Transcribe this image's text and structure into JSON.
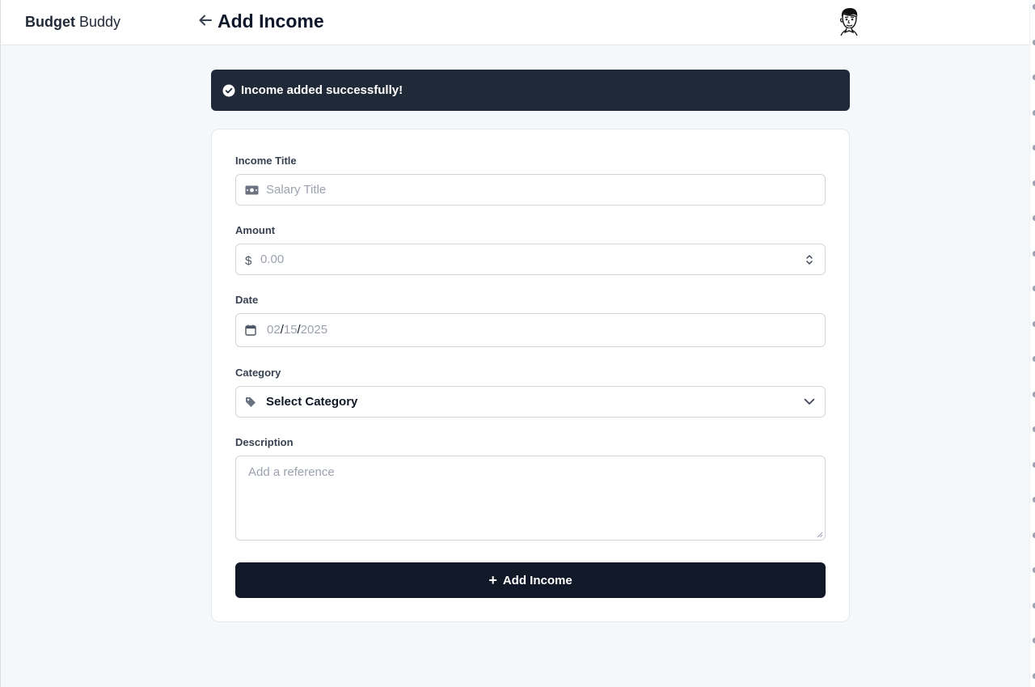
{
  "app": {
    "brand_bold": "Budget",
    "brand_regular": "Buddy"
  },
  "header": {
    "title": "Add Income",
    "back_icon": "arrow-left-icon",
    "avatar_icon": "user-avatar-illustration"
  },
  "toast": {
    "message": "Income added successfully!",
    "icon": "check-circle-icon"
  },
  "form": {
    "income_title": {
      "label": "Income Title",
      "placeholder": "Salary Title",
      "icon": "money-bill-icon"
    },
    "amount": {
      "label": "Amount",
      "prefix": "$",
      "placeholder": "0.00"
    },
    "date": {
      "label": "Date",
      "month": "02",
      "day": "15",
      "year": "2025",
      "sep": "/",
      "icon": "calendar-icon"
    },
    "category": {
      "label": "Category",
      "selected": "Select Category",
      "icon": "tag-icon"
    },
    "description": {
      "label": "Description",
      "placeholder": "Add a reference"
    },
    "submit": {
      "label": "Add Income",
      "icon": "plus-icon"
    }
  },
  "colors": {
    "toast_bg": "#1f2937",
    "button_bg": "#111827",
    "page_bg": "#f5f8fa"
  }
}
